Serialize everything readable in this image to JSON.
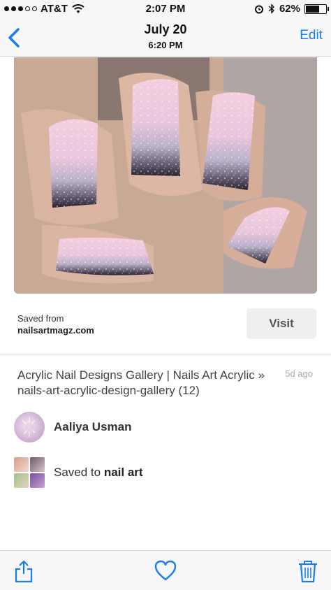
{
  "status_bar": {
    "carrier": "AT&T",
    "time": "2:07 PM",
    "battery": "62%",
    "battery_level": 0.62,
    "signal_bars_filled": 3,
    "signal_bars_total": 5
  },
  "nav": {
    "title": "July 20",
    "subtitle": "6:20 PM",
    "edit_label": "Edit",
    "accent_color": "#1a7cf3"
  },
  "photo": {
    "subject": "glitter ombre acrylic nails with black tips"
  },
  "source": {
    "saved_from_label": "Saved from",
    "domain": "nailsartmagz.com",
    "visit_label": "Visit"
  },
  "pin": {
    "description": "Acrylic Nail Designs Gallery | Nails Art Acrylic » nails-art-acrylic-design-gallery (12)",
    "time_ago": "5d ago"
  },
  "user": {
    "name": "Aaliya Usman"
  },
  "board": {
    "prefix": "Saved to",
    "name": "nail art"
  },
  "toolbar": {
    "icons": [
      "share-icon",
      "heart-icon",
      "trash-icon"
    ]
  }
}
